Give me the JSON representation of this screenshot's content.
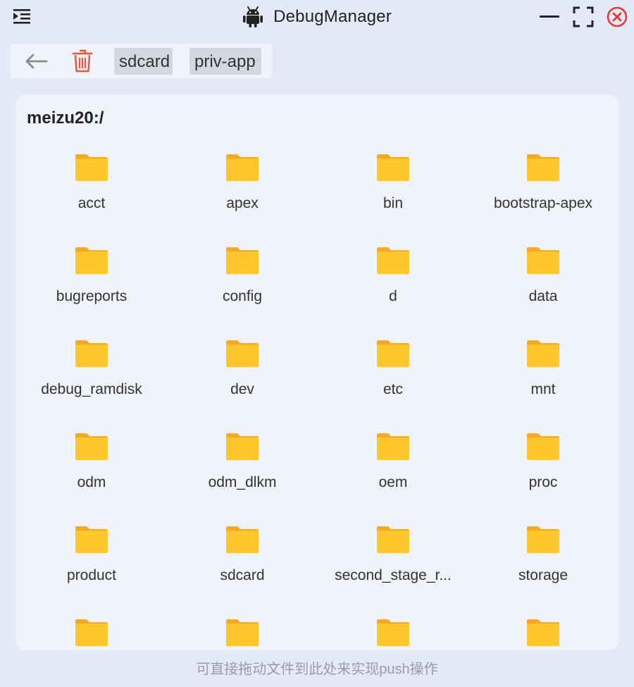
{
  "window": {
    "title": "DebugManager"
  },
  "toolbar": {
    "crumbs": [
      "sdcard",
      "priv-app"
    ]
  },
  "panel": {
    "path": "meizu20:/",
    "items": [
      "acct",
      "apex",
      "bin",
      "bootstrap-apex",
      "bugreports",
      "config",
      "d",
      "data",
      "debug_ramdisk",
      "dev",
      "etc",
      "mnt",
      "odm",
      "odm_dlkm",
      "oem",
      "proc",
      "product",
      "sdcard",
      "second_stage_r...",
      "storage",
      "",
      "",
      "",
      ""
    ]
  },
  "footer": {
    "hint": "可直接拖动文件到此处来实现push操作"
  },
  "colors": {
    "background": "#e4e9f7",
    "panel": "#f1f3fb",
    "folder": "#ffc72c",
    "folder_tab": "#f9a825",
    "close": "#e53935",
    "trash": "#e8553b"
  }
}
